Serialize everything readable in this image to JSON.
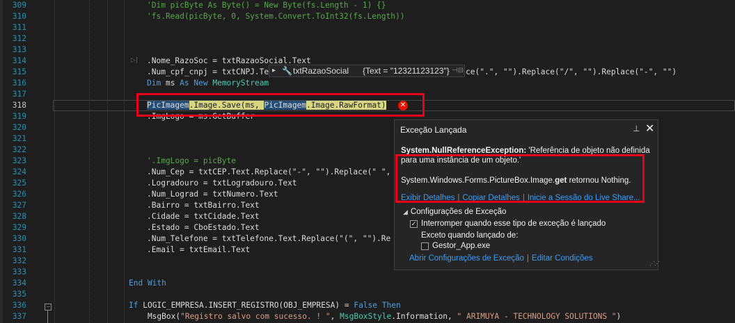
{
  "code_lines": [
    {
      "num": "309",
      "tokens": [
        {
          "t": "'Dim picByte As Byte() = New Byte(fs.Length - 1) {}",
          "c": "cm"
        }
      ]
    },
    {
      "num": "310",
      "tokens": [
        {
          "t": "'fs.Read(picByte, 0, System.Convert.ToInt32(fs.Length))",
          "c": "cm"
        }
      ]
    },
    {
      "num": "311",
      "tokens": []
    },
    {
      "num": "312",
      "tokens": []
    },
    {
      "num": "313",
      "tokens": []
    },
    {
      "num": "314",
      "tokens": [
        {
          "t": ".Nome_RazoSoc = txtRazaoSocial.Text",
          "c": ""
        }
      ]
    },
    {
      "num": "315",
      "tokens": [
        {
          "t": ".Num_cpf_cnpj = txtCNPJ.Te",
          "c": ""
        },
        {
          "t": "                                        ",
          "c": ""
        },
        {
          "t": "lace(\".\", \"\").Replace(\"/\", \"\").Replace(\"-\", \"\")",
          "c": ""
        }
      ]
    },
    {
      "num": "316",
      "tokens": [
        {
          "t": "Dim",
          "c": "kw"
        },
        {
          "t": " ms ",
          "c": ""
        },
        {
          "t": "As New",
          "c": "kw"
        },
        {
          "t": " ",
          "c": ""
        },
        {
          "t": "MemoryStream",
          "c": "ty"
        }
      ]
    },
    {
      "num": "317",
      "tokens": []
    },
    {
      "num": "318",
      "tokens": [
        {
          "t": "PicImagem",
          "c": "hl"
        },
        {
          "t": ".Image.Save(ms, ",
          "c": "yl"
        },
        {
          "t": "PicImagem",
          "c": "hl"
        },
        {
          "t": ".Image.RawFormat)",
          "c": "yl"
        }
      ]
    },
    {
      "num": "319",
      "tokens": [
        {
          "t": ".ImgLogo = ms.GetBuffer",
          "c": ""
        }
      ]
    },
    {
      "num": "320",
      "tokens": []
    },
    {
      "num": "321",
      "tokens": []
    },
    {
      "num": "322",
      "tokens": []
    },
    {
      "num": "323",
      "tokens": [
        {
          "t": "'.ImgLogo = picByte",
          "c": "cm"
        }
      ]
    },
    {
      "num": "324",
      "tokens": [
        {
          "t": ".Num_Cep = txtCEP.Text.Replace(\"-\", \"\").Replace(\" \",",
          "c": ""
        }
      ]
    },
    {
      "num": "325",
      "tokens": [
        {
          "t": ".Logradouro = txtLogradouro.Text",
          "c": ""
        }
      ]
    },
    {
      "num": "326",
      "tokens": [
        {
          "t": ".Num_Lograd = txtNumero.Text",
          "c": ""
        }
      ]
    },
    {
      "num": "327",
      "tokens": [
        {
          "t": ".Bairro = txtBairro.Text",
          "c": ""
        }
      ]
    },
    {
      "num": "328",
      "tokens": [
        {
          "t": ".Cidade = txtCidade.Text",
          "c": ""
        }
      ]
    },
    {
      "num": "329",
      "tokens": [
        {
          "t": ".Estado = CboEstado.Text",
          "c": ""
        }
      ]
    },
    {
      "num": "330",
      "tokens": [
        {
          "t": ".Num_Telefone = txtTelefone.Text.Replace(\"(\", \"\").Re",
          "c": ""
        }
      ]
    },
    {
      "num": "331",
      "tokens": [
        {
          "t": ".Email = txtEmail.Text",
          "c": ""
        }
      ]
    },
    {
      "num": "332",
      "tokens": []
    },
    {
      "num": "333",
      "tokens": []
    },
    {
      "num": "334",
      "tokens": [
        {
          "t": "End With",
          "c": "kw"
        }
      ]
    },
    {
      "num": "335",
      "tokens": []
    },
    {
      "num": "336",
      "tokens": [
        {
          "t": "If",
          "c": "kw"
        },
        {
          "t": " LOGIC_EMPRESA.INSERT_REGISTRO(OBJ_EMPRESA) = ",
          "c": ""
        },
        {
          "t": "False Then",
          "c": "kw"
        }
      ]
    },
    {
      "num": "337",
      "tokens": [
        {
          "t": "    MsgBox(",
          "c": ""
        },
        {
          "t": "\"Registro salvo com sucesso. ! \"",
          "c": "st"
        },
        {
          "t": ", ",
          "c": ""
        },
        {
          "t": "MsgBoxStyle",
          "c": "ty"
        },
        {
          "t": ".Information, ",
          "c": ""
        },
        {
          "t": "\" ARIMUYA - TECHNOLOGY SOLUTIONS \"",
          "c": "st"
        },
        {
          "t": ")",
          "c": ""
        }
      ]
    }
  ],
  "datatip": {
    "expand_glyph": "▸",
    "name": "txtRazaoSocial",
    "value": "{Text = \"12321123123\"}",
    "pin_glyph": "⊣⊟"
  },
  "exception": {
    "title": "Exceção Lançada",
    "pin_glyph": "▾",
    "close_glyph": "✕",
    "type": "System.NullReferenceException:",
    "message": " 'Referência de objeto não definida para uma instância de um objeto.'",
    "detail_prefix": "System.Windows.Forms.PictureBox.Image.",
    "detail_bold": "get",
    "detail_suffix": " retornou Nothing.",
    "link_details": "Exibir Detalhes",
    "link_copy": "Copiar Detalhes",
    "link_liveshare": "Inicie a Sessão do Live Share...",
    "settings_header": "Configurações de Exceção",
    "break_label": "Interromper quando esse tipo de exceção é lançado",
    "except_label": "Exceto quando lançado de:",
    "module_label": "Gestor_App.exe",
    "link_open_settings": "Abrir Configurações de Exceção",
    "link_edit_conditions": "Editar Condições"
  },
  "colors": {
    "error_box": "#e8001c",
    "link": "#3e9cf5",
    "line_number": "#2b91af"
  }
}
